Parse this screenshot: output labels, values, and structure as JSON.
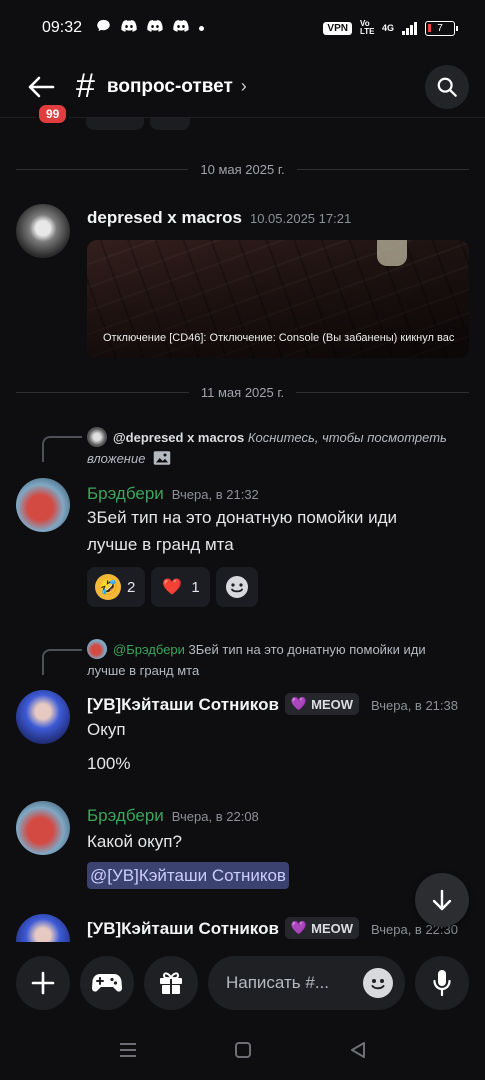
{
  "status_bar": {
    "time": "09:32",
    "vpn": "VPN",
    "volte": "Vo LTE",
    "network": "4G",
    "battery": "7"
  },
  "header": {
    "unread_count": "99",
    "hash": "#",
    "channel_name": "вопрос-ответ",
    "chevron": "›"
  },
  "dates": [
    "10 мая 2025 г.",
    "11 мая 2025 г."
  ],
  "messages": [
    {
      "author": "depresed x macros",
      "timestamp": "10.05.2025 17:21",
      "embed_caption": "Отключение [CD46]: Отключение: Console (Вы забанены) кикнул вас"
    },
    {
      "reply_author": "@depresed x macros",
      "reply_text": "Коснитесь, чтобы посмотреть вложение",
      "author": "Брэдбери",
      "timestamp": "Вчера, в 21:32",
      "text_line1": "3Бей  тип на это донатную помойки иди",
      "text_line2": "лучше в гранд мта",
      "reactions": [
        {
          "emoji": "🤣",
          "count": "2"
        },
        {
          "emoji": "❤️",
          "count": "1"
        }
      ]
    },
    {
      "reply_author": "@Брэдбери",
      "reply_text_line1": "3Бей  тип на это донатную помойки иди",
      "reply_text_line2": "лучше в гранд мта",
      "author": "[УВ]Кэйташи Сотников",
      "tag": "MEOW",
      "timestamp": "Вчера, в 21:38",
      "text_line1": "Окуп",
      "text_line2": "100%"
    },
    {
      "author": "Брэдбери",
      "timestamp": "Вчера, в 22:08",
      "text_line1": "Какой окуп?",
      "mention": "@[УВ]Кэйташи Сотников"
    },
    {
      "author": "[УВ]Кэйташи Сотников",
      "tag": "MEOW",
      "timestamp": "Вчера, в 22:30"
    }
  ],
  "composer": {
    "placeholder": "Написать #..."
  },
  "colors": {
    "background": "#0e0e10",
    "green_author": "#3ba55d",
    "mention_bg": "#3c4270",
    "badge_red": "#e03e3e"
  }
}
